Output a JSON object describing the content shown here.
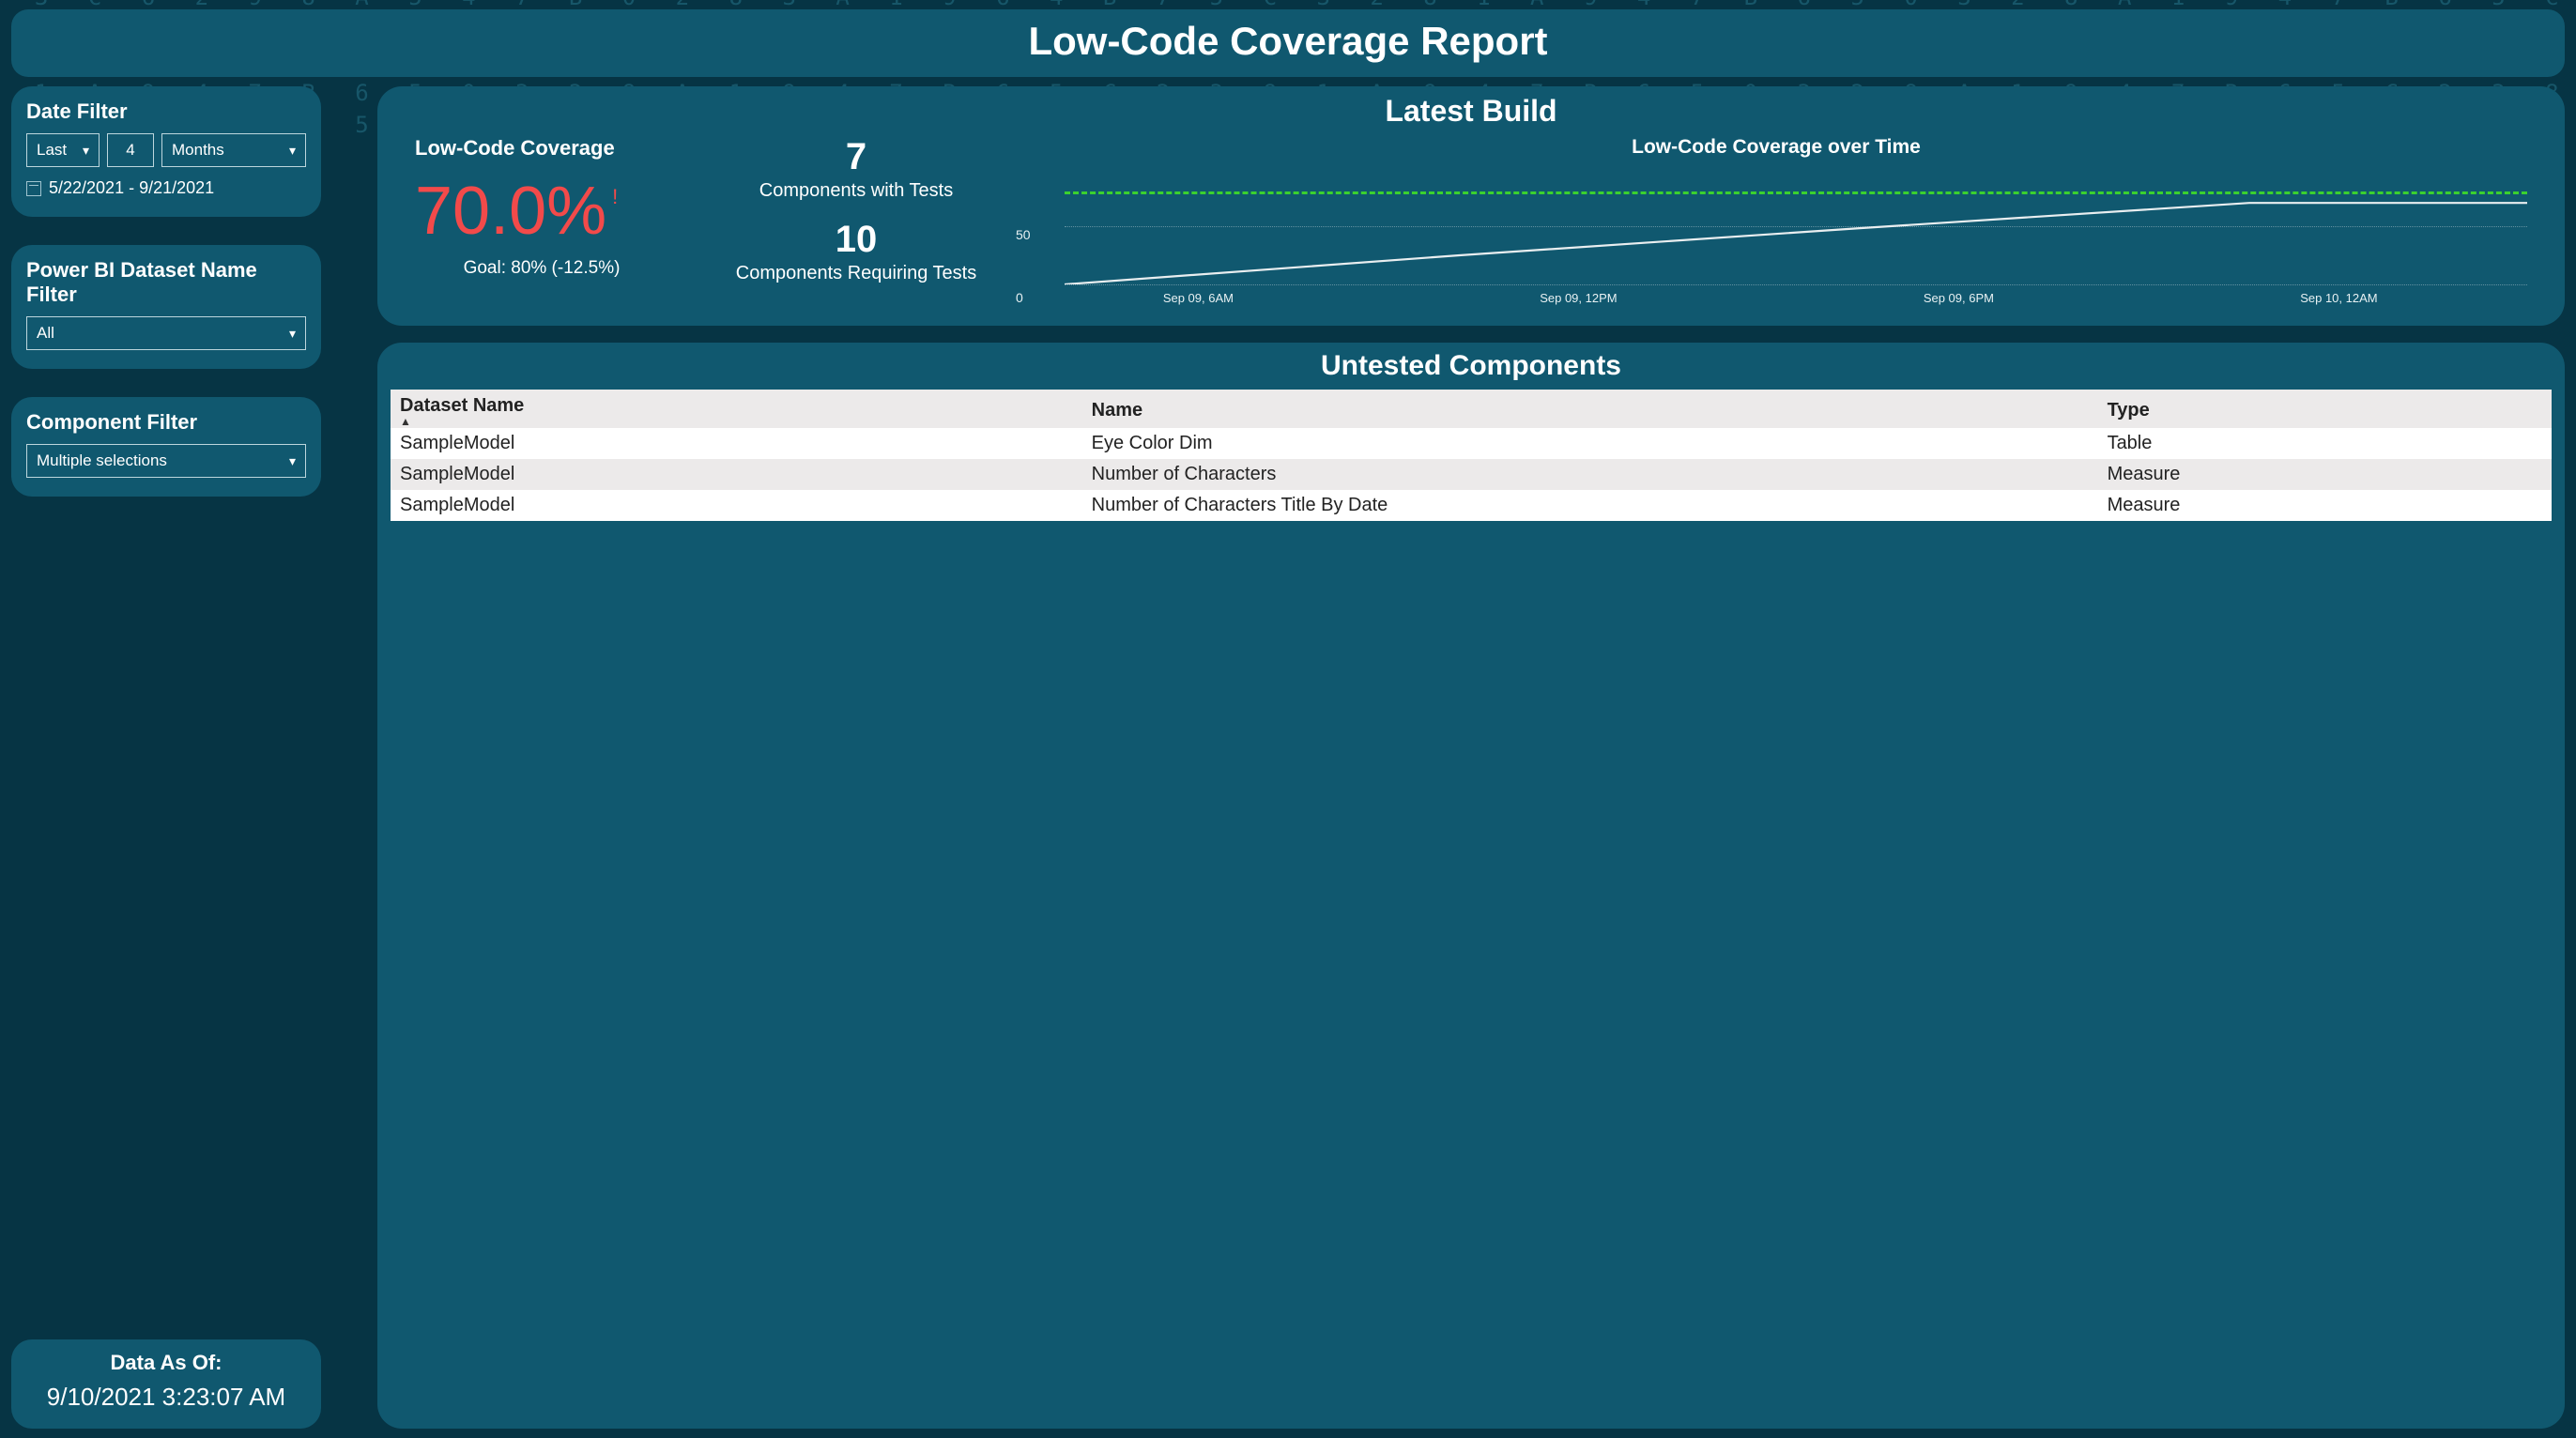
{
  "title": "Low-Code Coverage Report",
  "sidebar": {
    "date_filter": {
      "title": "Date Filter",
      "relative": "Last",
      "count": "4",
      "unit": "Months",
      "range": "5/22/2021 - 9/21/2021"
    },
    "dataset_filter": {
      "title": "Power BI Dataset Name Filter",
      "value": "All"
    },
    "component_filter": {
      "title": "Component Filter",
      "value": "Multiple selections"
    },
    "data_as_of": {
      "label": "Data As Of:",
      "value": "9/10/2021 3:23:07 AM"
    }
  },
  "latest_build": {
    "title": "Latest Build",
    "coverage": {
      "label": "Low-Code Coverage",
      "value": "70.0%",
      "goal_text": "Goal: 80% (-12.5%)"
    },
    "kpis": {
      "with_tests_value": "7",
      "with_tests_label": "Components with Tests",
      "requiring_value": "10",
      "requiring_label": "Components Requiring Tests"
    },
    "chart": {
      "title": "Low-Code Coverage over Time"
    }
  },
  "chart_data": {
    "type": "line",
    "title": "Low-Code Coverage over Time",
    "xlabel": "",
    "ylabel": "",
    "ylim": [
      0,
      100
    ],
    "y_ticks": [
      0,
      50
    ],
    "x_ticks": [
      "Sep 09, 6AM",
      "Sep 09, 12PM",
      "Sep 09, 6PM",
      "Sep 10, 12AM"
    ],
    "goal": 80,
    "series": [
      {
        "name": "Low-Code Coverage",
        "x": [
          "Sep 09, 6AM",
          "Sep 09, 12PM",
          "Sep 09, 6PM",
          "Sep 10, 12AM",
          "Sep 10, 3AM"
        ],
        "values": [
          0,
          25,
          48,
          70,
          70
        ]
      }
    ]
  },
  "untested": {
    "title": "Untested Components",
    "columns": [
      "Dataset Name",
      "Name",
      "Type"
    ],
    "rows": [
      {
        "dataset": "SampleModel",
        "name": "Eye Color Dim",
        "type": "Table"
      },
      {
        "dataset": "SampleModel",
        "name": "Number of Characters",
        "type": "Measure"
      },
      {
        "dataset": "SampleModel",
        "name": "Number of Characters Title By Date",
        "type": "Measure"
      }
    ]
  },
  "colors": {
    "panel": "#10586f",
    "accent_bad": "#f24a4a",
    "goal_line": "#3bd12e"
  }
}
